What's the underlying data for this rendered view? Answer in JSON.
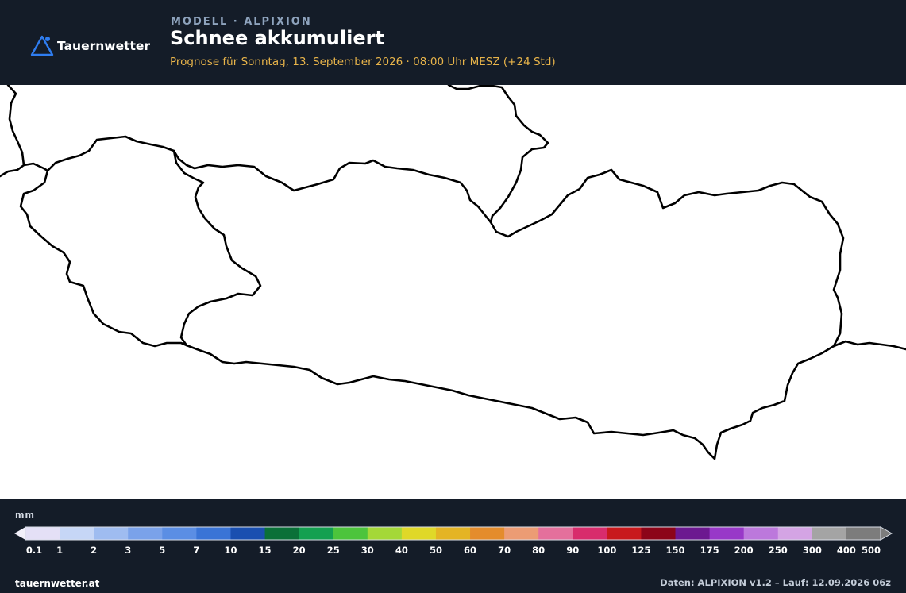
{
  "header": {
    "brand": "Tauernwetter",
    "eyebrow": "MODELL · ALPIXION",
    "title": "Schnee akkumuliert",
    "subtitle": "Prognose für Sonntag, 13. September 2026 · 08:00 Uhr MESZ  (+24 Std)",
    "logo_icon": "mountain-triangle-icon",
    "accent_color": "#e8b44a",
    "brand_icon_color": "#2f7df0"
  },
  "map": {
    "background": "#ffffff",
    "border_color": "#000000",
    "snow_shown": false
  },
  "legend": {
    "unit": "mm",
    "labels": [
      "0.1",
      "1",
      "2",
      "3",
      "5",
      "7",
      "10",
      "15",
      "20",
      "25",
      "30",
      "40",
      "50",
      "60",
      "70",
      "80",
      "90",
      "100",
      "125",
      "150",
      "175",
      "200",
      "250",
      "300",
      "400",
      "500"
    ],
    "colors": [
      "#e4e0f6",
      "#c6d6f6",
      "#9fbcf0",
      "#7aa2ea",
      "#5b8ee4",
      "#3a74d6",
      "#1a4fb0",
      "#0a7038",
      "#14a050",
      "#4cc43c",
      "#a4d838",
      "#e0d828",
      "#e4b424",
      "#e48c2c",
      "#ec9c74",
      "#e4709c",
      "#d82c6c",
      "#c8181c",
      "#8c0418",
      "#6c1890",
      "#9838c8",
      "#bc78dc",
      "#d4a4e4",
      "#a4a4a4",
      "#7c7c7c"
    ]
  },
  "footer": {
    "site": "tauernwetter.at",
    "source": "Daten: ALPIXION v1.2 – Lauf: 12.09.2026 06z"
  }
}
